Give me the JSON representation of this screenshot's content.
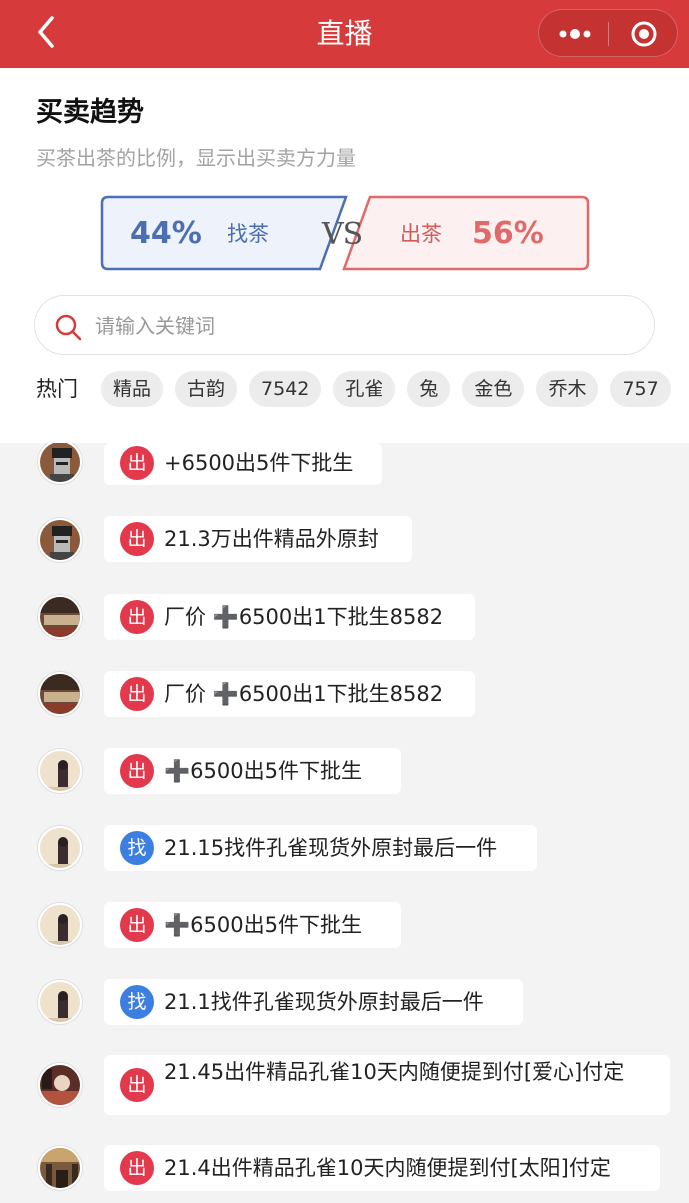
{
  "navbar": {
    "title": "直播",
    "colors": {
      "bg": "#d63a3a"
    }
  },
  "trend": {
    "title": "买卖趋势",
    "subtitle": "买茶出茶的比例，显示出买卖方力量",
    "left": {
      "percent": "44%",
      "label": "找茶",
      "color": "#4b6fb0"
    },
    "vs": "VS",
    "right": {
      "percent": "56%",
      "label": "出茶",
      "color": "#e06a6a"
    }
  },
  "search": {
    "placeholder": "请输入关键词",
    "value": ""
  },
  "hot": {
    "label": "热门",
    "tags": [
      "精品",
      "古韵",
      "7542",
      "孔雀",
      "兔",
      "金色",
      "乔木",
      "757"
    ]
  },
  "feed": {
    "items": [
      {
        "type": "出",
        "text": "+6500出5件下批生",
        "avatar": "pixel-avatar"
      },
      {
        "type": "出",
        "text": "21.3万出件精品外原封",
        "avatar": "pixel-avatar"
      },
      {
        "type": "出",
        "text": "厂价 ➕6500出1下批生8582",
        "avatar": "shop-avatar"
      },
      {
        "type": "出",
        "text": "厂价 ➕6500出1下批生8582",
        "avatar": "shop-avatar"
      },
      {
        "type": "出",
        "text": "➕6500出5件下批生",
        "avatar": "girl-avatar"
      },
      {
        "type": "找",
        "text": "21.15找件孔雀现货外原封最后一件",
        "avatar": "girl-avatar"
      },
      {
        "type": "出",
        "text": "➕6500出5件下批生",
        "avatar": "girl-avatar"
      },
      {
        "type": "找",
        "text": "21.1找件孔雀现货外原封最后一件",
        "avatar": "girl-avatar"
      },
      {
        "type": "出",
        "text": "21.45出件精品孔雀10天内随便提到付[爱心]付定",
        "avatar": "room-avatar"
      },
      {
        "type": "出",
        "text": "21.4出件精品孔雀10天内随便提到付[太阳]付定",
        "avatar": "hall-avatar"
      }
    ]
  }
}
